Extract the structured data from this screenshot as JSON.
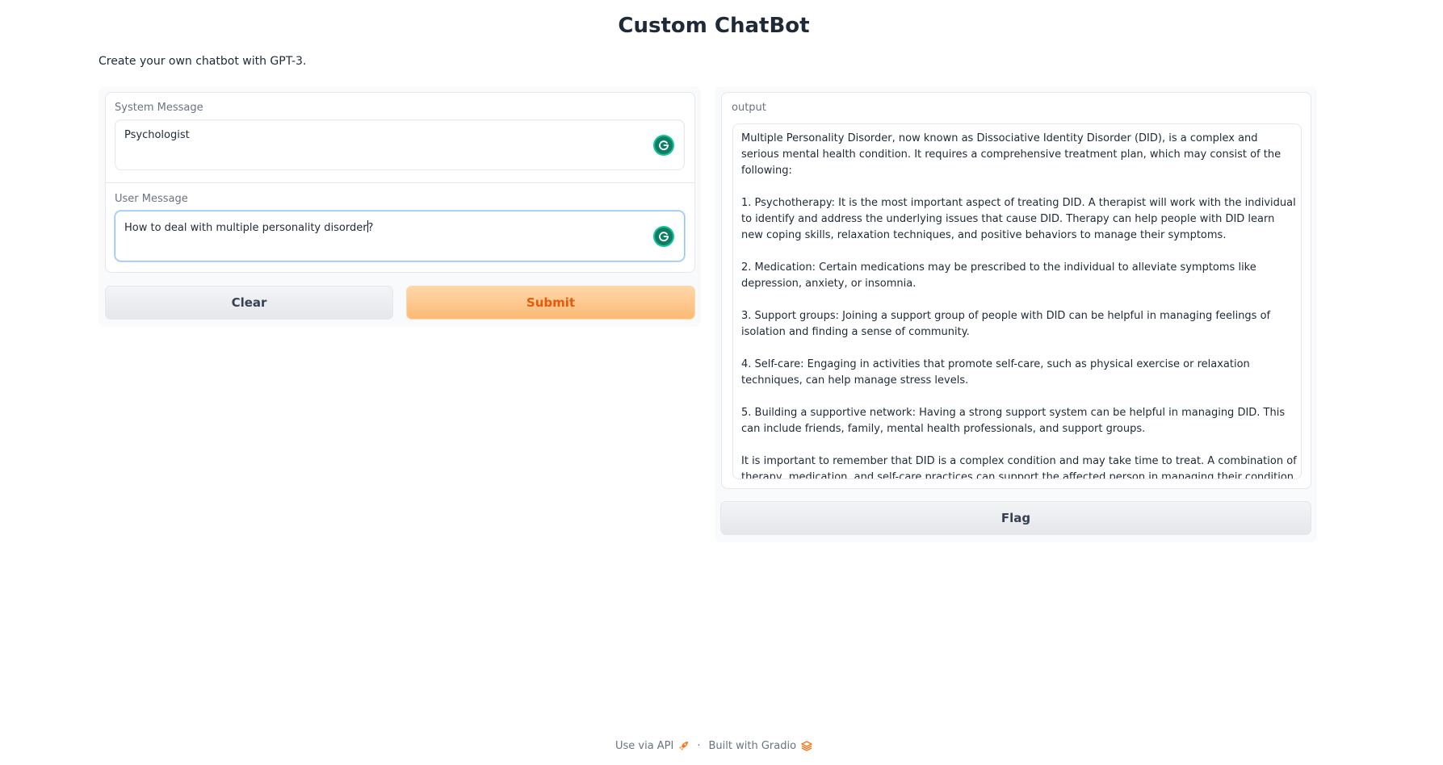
{
  "page": {
    "title": "Custom ChatBot",
    "description": "Create your own chatbot with GPT-3."
  },
  "inputs": {
    "system_label": "System Message",
    "system_value": "Psychologist",
    "user_label": "User Message",
    "user_value_before_caret": "How to deal with multiple personality disorder",
    "user_value_after_caret": "?"
  },
  "buttons": {
    "clear": "Clear",
    "submit": "Submit",
    "flag": "Flag"
  },
  "output": {
    "label": "output",
    "paragraphs": [
      "Multiple Personality Disorder, now known as Dissociative Identity Disorder (DID), is a complex and serious mental health condition. It requires a comprehensive treatment plan, which may consist of the following:",
      "1. Psychotherapy: It is the most important aspect of treating DID. A therapist will work with the individual to identify and address the underlying issues that cause DID. Therapy can help people with DID learn new coping skills, relaxation techniques, and positive behaviors to manage their symptoms.",
      "2. Medication: Certain medications may be prescribed to the individual to alleviate symptoms like depression, anxiety, or insomnia.",
      "3. Support groups: Joining a support group of people with DID can be helpful in managing feelings of isolation and finding a sense of community.",
      "4. Self-care: Engaging in activities that promote self-care, such as physical exercise or relaxation techniques, can help manage stress levels.",
      "5. Building a supportive network: Having a strong support system can be helpful in managing DID. This can include friends, family, mental health professionals, and support groups.",
      "It is important to remember that DID is a complex condition and may take time to treat. A combination of therapy, medication, and self-care practices can support the affected person in managing their condition and improve their quality of life."
    ]
  },
  "footer": {
    "api_link": "Use via API",
    "separator": "·",
    "built_with": "Built with Gradio"
  },
  "icons": {
    "grammarly": "grammarly-icon",
    "rocket": "rocket-icon",
    "gradio": "gradio-logo-icon"
  },
  "colors": {
    "accent_orange": "#ea580c",
    "grammarly_green": "#15c39a",
    "focus_blue": "#93c5fd"
  }
}
